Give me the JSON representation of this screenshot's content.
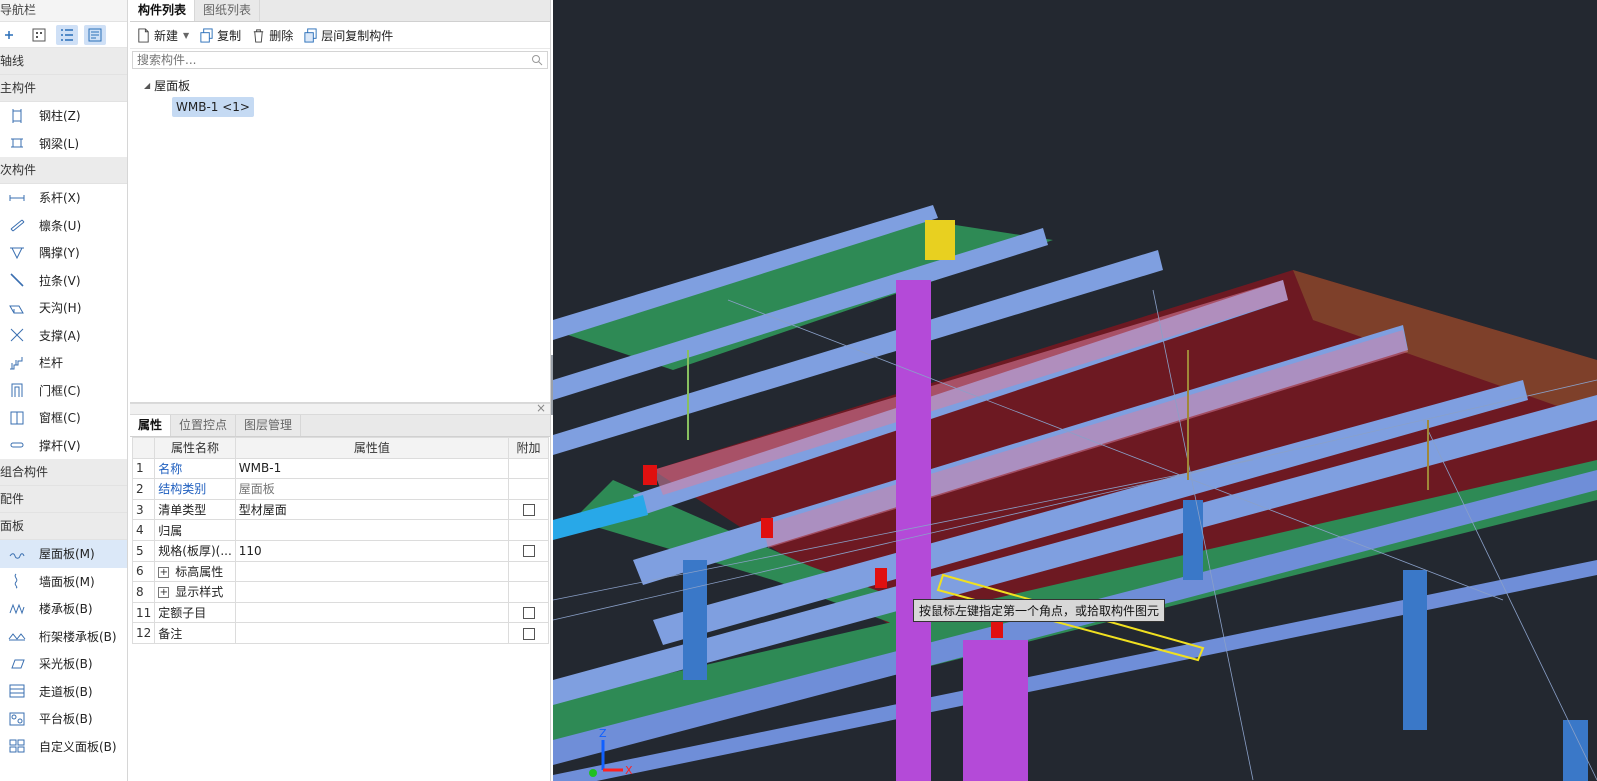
{
  "nav": {
    "title": "导航栏",
    "groups": [
      {
        "label": "轴线"
      },
      {
        "label": "主构件",
        "items": [
          {
            "label": "钢柱(Z)",
            "icon": "steel-column-icon"
          },
          {
            "label": "钢梁(L)",
            "icon": "steel-beam-icon"
          }
        ]
      },
      {
        "label": "次构件",
        "items": [
          {
            "label": "系杆(X)",
            "icon": "tie-rod-icon"
          },
          {
            "label": "檩条(U)",
            "icon": "purlin-icon"
          },
          {
            "label": "隅撑(Y)",
            "icon": "corner-brace-icon"
          },
          {
            "label": "拉条(V)",
            "icon": "sag-rod-icon"
          },
          {
            "label": "天沟(H)",
            "icon": "gutter-icon"
          },
          {
            "label": "支撑(A)",
            "icon": "bracing-icon"
          },
          {
            "label": "栏杆",
            "icon": "railing-icon"
          },
          {
            "label": "门框(C)",
            "icon": "door-frame-icon"
          },
          {
            "label": "窗框(C)",
            "icon": "window-frame-icon"
          },
          {
            "label": "撑杆(V)",
            "icon": "strut-icon"
          }
        ]
      },
      {
        "label": "组合构件"
      },
      {
        "label": "配件"
      },
      {
        "label": "面板",
        "items": [
          {
            "label": "屋面板(M)",
            "icon": "roof-panel-icon",
            "selected": true
          },
          {
            "label": "墙面板(M)",
            "icon": "wall-panel-icon"
          },
          {
            "label": "楼承板(B)",
            "icon": "floor-deck-icon"
          },
          {
            "label": "桁架楼承板(B)",
            "icon": "truss-deck-icon"
          },
          {
            "label": "采光板(B)",
            "icon": "skylight-panel-icon"
          },
          {
            "label": "走道板(B)",
            "icon": "walkway-panel-icon"
          },
          {
            "label": "平台板(B)",
            "icon": "platform-panel-icon"
          },
          {
            "label": "自定义面板(B)",
            "icon": "custom-panel-icon"
          }
        ]
      }
    ]
  },
  "components": {
    "tabs": [
      "构件列表",
      "图纸列表"
    ],
    "toolbar": {
      "new": "新建",
      "copy": "复制",
      "delete": "删除",
      "floor_copy": "层间复制构件"
    },
    "search_placeholder": "搜索构件...",
    "tree": {
      "category": "屋面板",
      "item": "WMB-1 <1>"
    }
  },
  "properties": {
    "tabs": [
      "属性",
      "位置控点",
      "图层管理"
    ],
    "headers": {
      "name": "属性名称",
      "value": "属性值",
      "extra": "附加"
    },
    "rows": [
      {
        "n": "1",
        "name": "名称",
        "value": "WMB-1",
        "blue": true,
        "check": false
      },
      {
        "n": "2",
        "name": "结构类别",
        "value": "屋面板",
        "blue": true,
        "gray": true,
        "check": false
      },
      {
        "n": "3",
        "name": "清单类型",
        "value": "型材屋面",
        "check": true
      },
      {
        "n": "4",
        "name": "归属",
        "value": "",
        "check": false
      },
      {
        "n": "5",
        "name": "规格(板厚)(...",
        "value": "110",
        "check": true
      },
      {
        "n": "6",
        "name": "标高属性",
        "value": "",
        "expand": true,
        "check": false
      },
      {
        "n": "8",
        "name": "显示样式",
        "value": "",
        "expand": true,
        "check": false
      },
      {
        "n": "11",
        "name": "定额子目",
        "value": "",
        "check": true
      },
      {
        "n": "12",
        "name": "备注",
        "value": "",
        "check": true
      }
    ]
  },
  "viewport": {
    "tooltip": "按鼠标左键指定第一个角点，或拾取构件图元",
    "axis_labels": [
      "Z",
      "X"
    ]
  }
}
